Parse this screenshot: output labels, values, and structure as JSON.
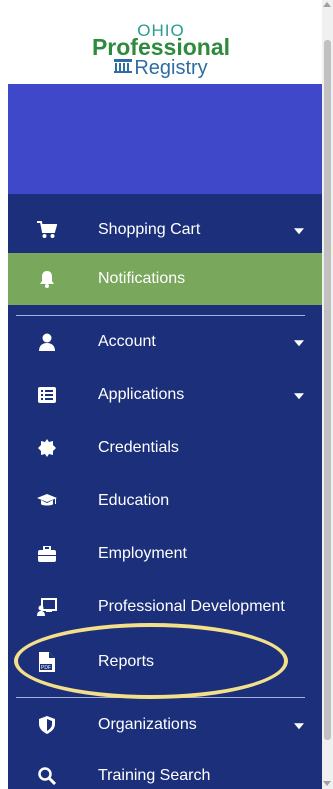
{
  "logo": {
    "line1": "OHIO",
    "line2": "Professional",
    "line3": "Registry"
  },
  "colors": {
    "sidebar": "#1b2f7a",
    "banner": "#3f48c9",
    "active": "#79a85c",
    "highlight": "#f4e08a"
  },
  "menu": [
    {
      "label": "Shopping Cart",
      "icon": "cart-icon",
      "expandable": true
    },
    {
      "label": "Notifications",
      "icon": "bell-icon",
      "active": true
    },
    {
      "label": "Account",
      "icon": "user-icon",
      "expandable": true
    },
    {
      "label": "Applications",
      "icon": "list-icon",
      "expandable": true
    },
    {
      "label": "Credentials",
      "icon": "badge-icon"
    },
    {
      "label": "Education",
      "icon": "graduation-cap-icon"
    },
    {
      "label": "Employment",
      "icon": "briefcase-icon"
    },
    {
      "label": "Professional Development",
      "icon": "presentation-icon"
    },
    {
      "label": "Reports",
      "icon": "pdf-file-icon"
    },
    {
      "label": "Organizations",
      "icon": "shield-icon",
      "expandable": true
    },
    {
      "label": "Training Search",
      "icon": "search-icon"
    }
  ]
}
